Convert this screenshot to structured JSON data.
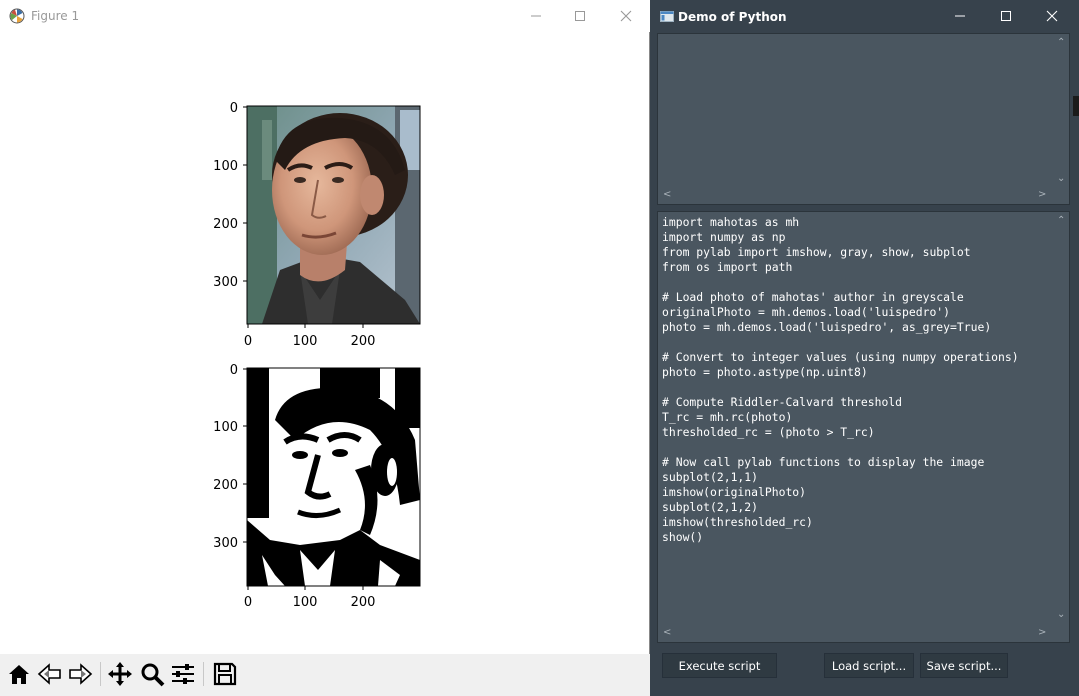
{
  "figure_window": {
    "title": "Figure 1",
    "controls": {
      "minimize": "minimize-icon",
      "maximize": "maximize-icon",
      "close": "close-icon"
    },
    "subplots": [
      {
        "image": "color photo of a man (original photo)",
        "y_ticks": [
          "0",
          "100",
          "200",
          "300"
        ],
        "x_ticks": [
          "0",
          "100",
          "200"
        ]
      },
      {
        "image": "black and white thresholded photo",
        "y_ticks": [
          "0",
          "100",
          "200",
          "300"
        ],
        "x_ticks": [
          "0",
          "100",
          "200"
        ]
      }
    ],
    "toolbar": [
      "home-icon",
      "back-icon",
      "forward-icon",
      "pan-icon",
      "zoom-icon",
      "configure-subplots-icon",
      "save-icon"
    ]
  },
  "demo_window": {
    "title": "Demo of Python",
    "controls": {
      "minimize": "minimize-icon",
      "maximize": "maximize-icon",
      "close": "close-icon"
    },
    "output_text": "",
    "code_lines": [
      "import mahotas as mh",
      "import numpy as np",
      "from pylab import imshow, gray, show, subplot",
      "from os import path",
      "",
      "# Load photo of mahotas' author in greyscale",
      "originalPhoto = mh.demos.load('luispedro')",
      "photo = mh.demos.load('luispedro', as_grey=True)",
      "",
      "# Convert to integer values (using numpy operations)",
      "photo = photo.astype(np.uint8)",
      "",
      "# Compute Riddler-Calvard threshold",
      "T_rc = mh.rc(photo)",
      "thresholded_rc = (photo > T_rc)",
      "",
      "# Now call pylab functions to display the image",
      "subplot(2,1,1)",
      "imshow(originalPhoto)",
      "subplot(2,1,2)",
      "imshow(thresholded_rc)",
      "show()"
    ],
    "buttons": {
      "execute": "Execute script",
      "load": "Load script...",
      "save": "Save script..."
    }
  }
}
